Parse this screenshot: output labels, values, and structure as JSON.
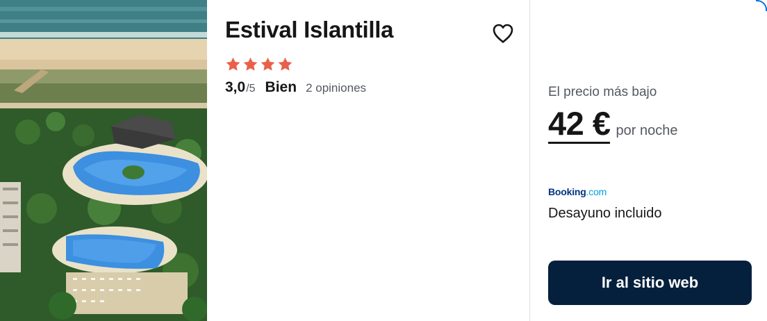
{
  "hotel": {
    "name": "Estival Islantilla",
    "stars": 4,
    "rating_score": "3,0",
    "rating_scale": "/5",
    "rating_word": "Bien",
    "reviews": "2 opiniones"
  },
  "price_panel": {
    "lowest_label": "El precio más bajo",
    "price": "42 €",
    "per_night": "por noche",
    "provider_part1": "Booking",
    "provider_part2": ".com",
    "extra": "Desayuno incluido",
    "cta_label": "Ir al sitio web"
  },
  "icons": {
    "favorite": "heart-outline-icon",
    "star": "star-icon"
  },
  "colors": {
    "star": "#e9604a",
    "cta_background": "#05203c",
    "provider_dark": "#003580",
    "provider_light": "#00a1e0",
    "accent_border": "#0770e3"
  }
}
